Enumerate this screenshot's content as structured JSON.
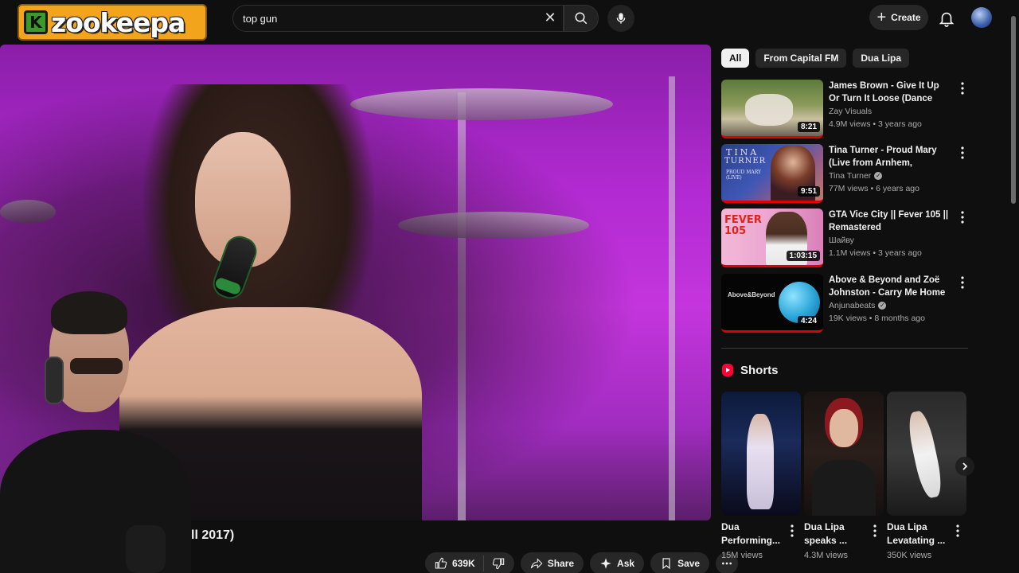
{
  "header": {
    "logo_letter": "K",
    "logo_text": "zookeepa",
    "search_value": "top gun",
    "create_label": "Create"
  },
  "video": {
    "title_partial": "ll 2017)",
    "likes": "639K",
    "share_label": "Share",
    "ask_label": "Ask",
    "save_label": "Save"
  },
  "chips": [
    {
      "label": "All",
      "active": true
    },
    {
      "label": "From Capital FM",
      "active": false
    },
    {
      "label": "Dua Lipa",
      "active": false
    }
  ],
  "recommendations": [
    {
      "title": "James Brown - Give It Up Or Turn It Loose (Dance Clip) ...",
      "channel": "Zay Visuals",
      "verified": false,
      "meta": "4.9M views • 3 years ago",
      "duration": "8:21"
    },
    {
      "title": "Tina Turner - Proud Mary (Live from Arnhem, Netherlands)",
      "channel": "Tina Turner",
      "verified": true,
      "meta": "77M views • 6 years ago",
      "duration": "9:51"
    },
    {
      "title": "GTA Vice City || Fever 105 || Remastered",
      "channel": "Шайву",
      "verified": false,
      "meta": "1.1M views • 3 years ago",
      "duration": "1:03:15"
    },
    {
      "title": "Above & Beyond and Zoë Johnston - Carry Me Home ...",
      "channel": "Anjunabeats",
      "verified": true,
      "meta": "19K views • 8 months ago",
      "duration": "4:24"
    }
  ],
  "shorts": {
    "heading": "Shorts",
    "items": [
      {
        "title": "Dua Performing...",
        "views": "15M views"
      },
      {
        "title": "Dua Lipa speaks ...",
        "views": "4.3M views"
      },
      {
        "title": "Dua Lipa Levatating ...",
        "views": "350K views"
      }
    ]
  },
  "thumb_text": {
    "tina_top": "TINA",
    "tina_bottom": "TURNER",
    "tina_sub": "PROUD MARY (LIVE)",
    "fever": "FEVER 105",
    "above_beyond": "Above&Beyond"
  },
  "colors": {
    "background": "#0f0f0f",
    "accent_red": "#e10000",
    "logo_orange": "#f2a51c"
  }
}
